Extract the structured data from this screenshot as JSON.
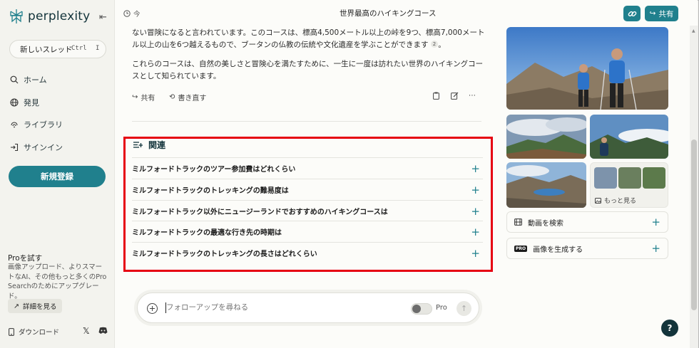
{
  "sidebar": {
    "brand": "perplexity",
    "new_thread": "新しいスレッド",
    "shortcut_ctrl": "Ctrl",
    "shortcut_key": "I",
    "nav": [
      "ホーム",
      "発見",
      "ライブラリ",
      "サインイン"
    ],
    "signup": "新規登録",
    "pro_title": "Proを試す",
    "pro_desc": "画像アップロード、よりスマートなAI、その他もっと多くのPro Searchのためにアップグレード。",
    "details": "詳細を見る",
    "download": "ダウンロード"
  },
  "header": {
    "time": "今",
    "title": "世界最高のハイキングコース",
    "share": "共有"
  },
  "answer": {
    "para1": "ない冒険になると言われています。このコースは、標高4,500メートル以上の峠を9つ、標高7,000メートル以上の山を6つ越えるもので、ブータンの仏教の伝統や文化遺産を学ぶことができます",
    "para1_cite": "2",
    "para1_end": "。",
    "para2": "これらのコースは、自然の美しさと冒険心を満たすために、一生に一度は訪れたい世界のハイキングコースとして知られています。",
    "share": "共有",
    "rewrite": "書き直す"
  },
  "related": {
    "title": "関連",
    "items": [
      "ミルフォードトラックのツアー参加費はどれくらい",
      "ミルフォードトラックのトレッキングの難易度は",
      "ミルフォードトラック以外にニュージーランドでおすすめのハイキングコースは",
      "ミルフォードトラックの最適な行き先の時期は",
      "ミルフォードトラックのトレッキングの長さはどれくらい"
    ]
  },
  "followup": {
    "placeholder": "フォローアップを尋ねる",
    "pro": "Pro"
  },
  "media": {
    "more": "もっと見る",
    "search_video": "動画を検索",
    "generate_image": "画像を生成する"
  },
  "colors": {
    "accent": "#20808d",
    "highlight": "#e60012"
  }
}
